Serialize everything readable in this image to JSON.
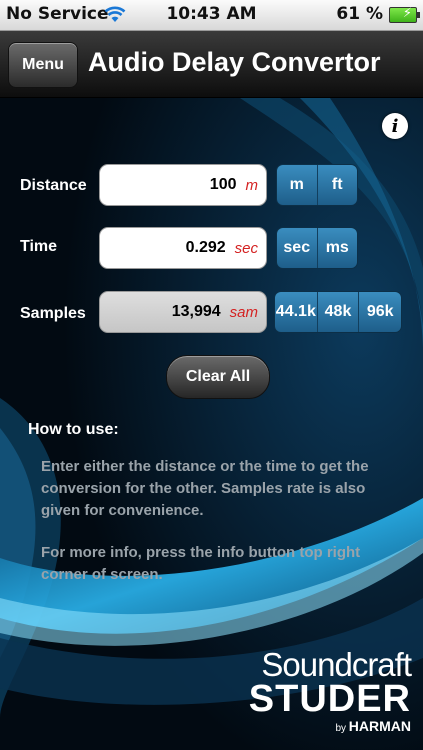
{
  "status_bar": {
    "carrier": "No Service",
    "time": "10:43 AM",
    "battery_percent": "61 %",
    "wifi_icon": "wifi-icon",
    "battery_icon": "battery-charging-icon"
  },
  "nav": {
    "menu_label": "Menu",
    "title": "Audio Delay Convertor"
  },
  "info_button": {
    "label": "i",
    "icon": "info-icon"
  },
  "rows": {
    "distance": {
      "label": "Distance",
      "value": "100",
      "unit": "m",
      "options": [
        "m",
        "ft"
      ]
    },
    "time": {
      "label": "Time",
      "value": "0.292",
      "unit": "sec",
      "options": [
        "sec",
        "ms"
      ]
    },
    "samples": {
      "label": "Samples",
      "value": "13,994",
      "unit": "sam",
      "options": [
        "44.1k",
        "48k",
        "96k"
      ]
    }
  },
  "clear_button": {
    "label": "Clear All"
  },
  "howto": {
    "title": "How to use:",
    "paragraph1": "Enter either the distance or the time to get the conversion for the other. Samples rate is also given for convenience.",
    "paragraph2": "For more info, press the info button top right corner of screen."
  },
  "logo": {
    "line1": "Soundcraft",
    "line2": "STUDER",
    "by": "by",
    "brand": "HARMAN"
  },
  "colors": {
    "segment_blue": "#2a76a8",
    "unit_red": "#d42222",
    "accent_glow": "#1fa8e8"
  }
}
